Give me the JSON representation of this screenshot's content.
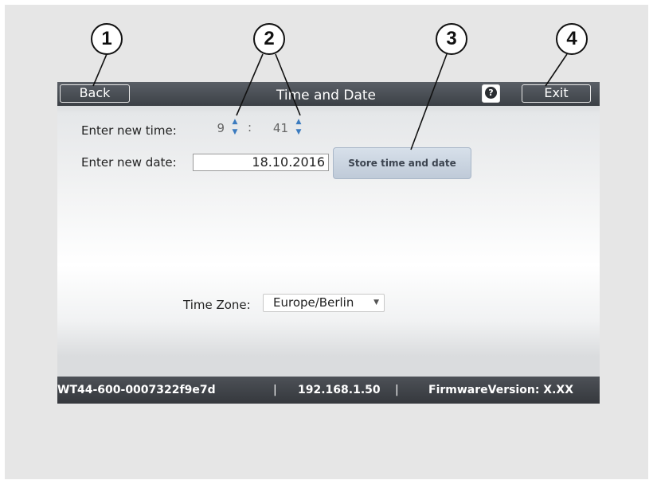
{
  "callouts": [
    "1",
    "2",
    "3",
    "4"
  ],
  "titlebar": {
    "back_label": "Back",
    "title": "Time and Date",
    "help_label": "?",
    "exit_label": "Exit"
  },
  "time": {
    "label": "Enter new time:",
    "hour": "9",
    "separator": ":",
    "minute": "41"
  },
  "date": {
    "label": "Enter new date:",
    "value": "18.10.2016"
  },
  "store_button": "Store time and date",
  "timezone": {
    "label": "Time Zone:",
    "selected": "Europe/Berlin",
    "caret_icon": "chevron-down-icon"
  },
  "statusbar": {
    "device_id": "WT44-600-0007322f9e7d",
    "separator": "|",
    "ip": "192.168.1.50",
    "firmware": "FirmwareVersion: X.XX"
  },
  "colors": {
    "titlebar": "#4a4e55",
    "statusbar": "#3e4247",
    "store_button": "#c8d3e0",
    "spinner_arrow": "#3b7bbf"
  }
}
